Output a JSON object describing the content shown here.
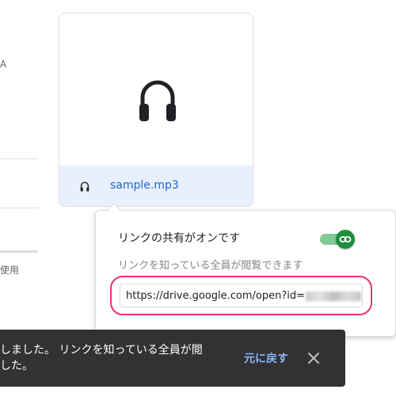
{
  "left_panel": {
    "fragment_letter": "A",
    "fragment_usage": "使用"
  },
  "file_card": {
    "file_name": "sample.mp3",
    "preview_icon": "headphones-icon",
    "type_icon": "headphones-icon"
  },
  "share_popup": {
    "title": "リンクの共有がオンです",
    "toggle_state": "on",
    "toggle_icon": "link-icon",
    "description": "リンクを知っている全員が閲覧できます",
    "link_prefix": "https://drive.google.com/open?id="
  },
  "snackbar": {
    "message": "しました。 リンクを知っている全員が閲\nした。",
    "undo_label": "元に戻す",
    "close_icon": "close-icon"
  },
  "colors": {
    "accent_blue": "#1967d2",
    "toggle_green": "#1e8e3e",
    "highlight_pink": "#e8336e",
    "snackbar_bg": "#323232",
    "undo_blue": "#8ab4f8"
  }
}
